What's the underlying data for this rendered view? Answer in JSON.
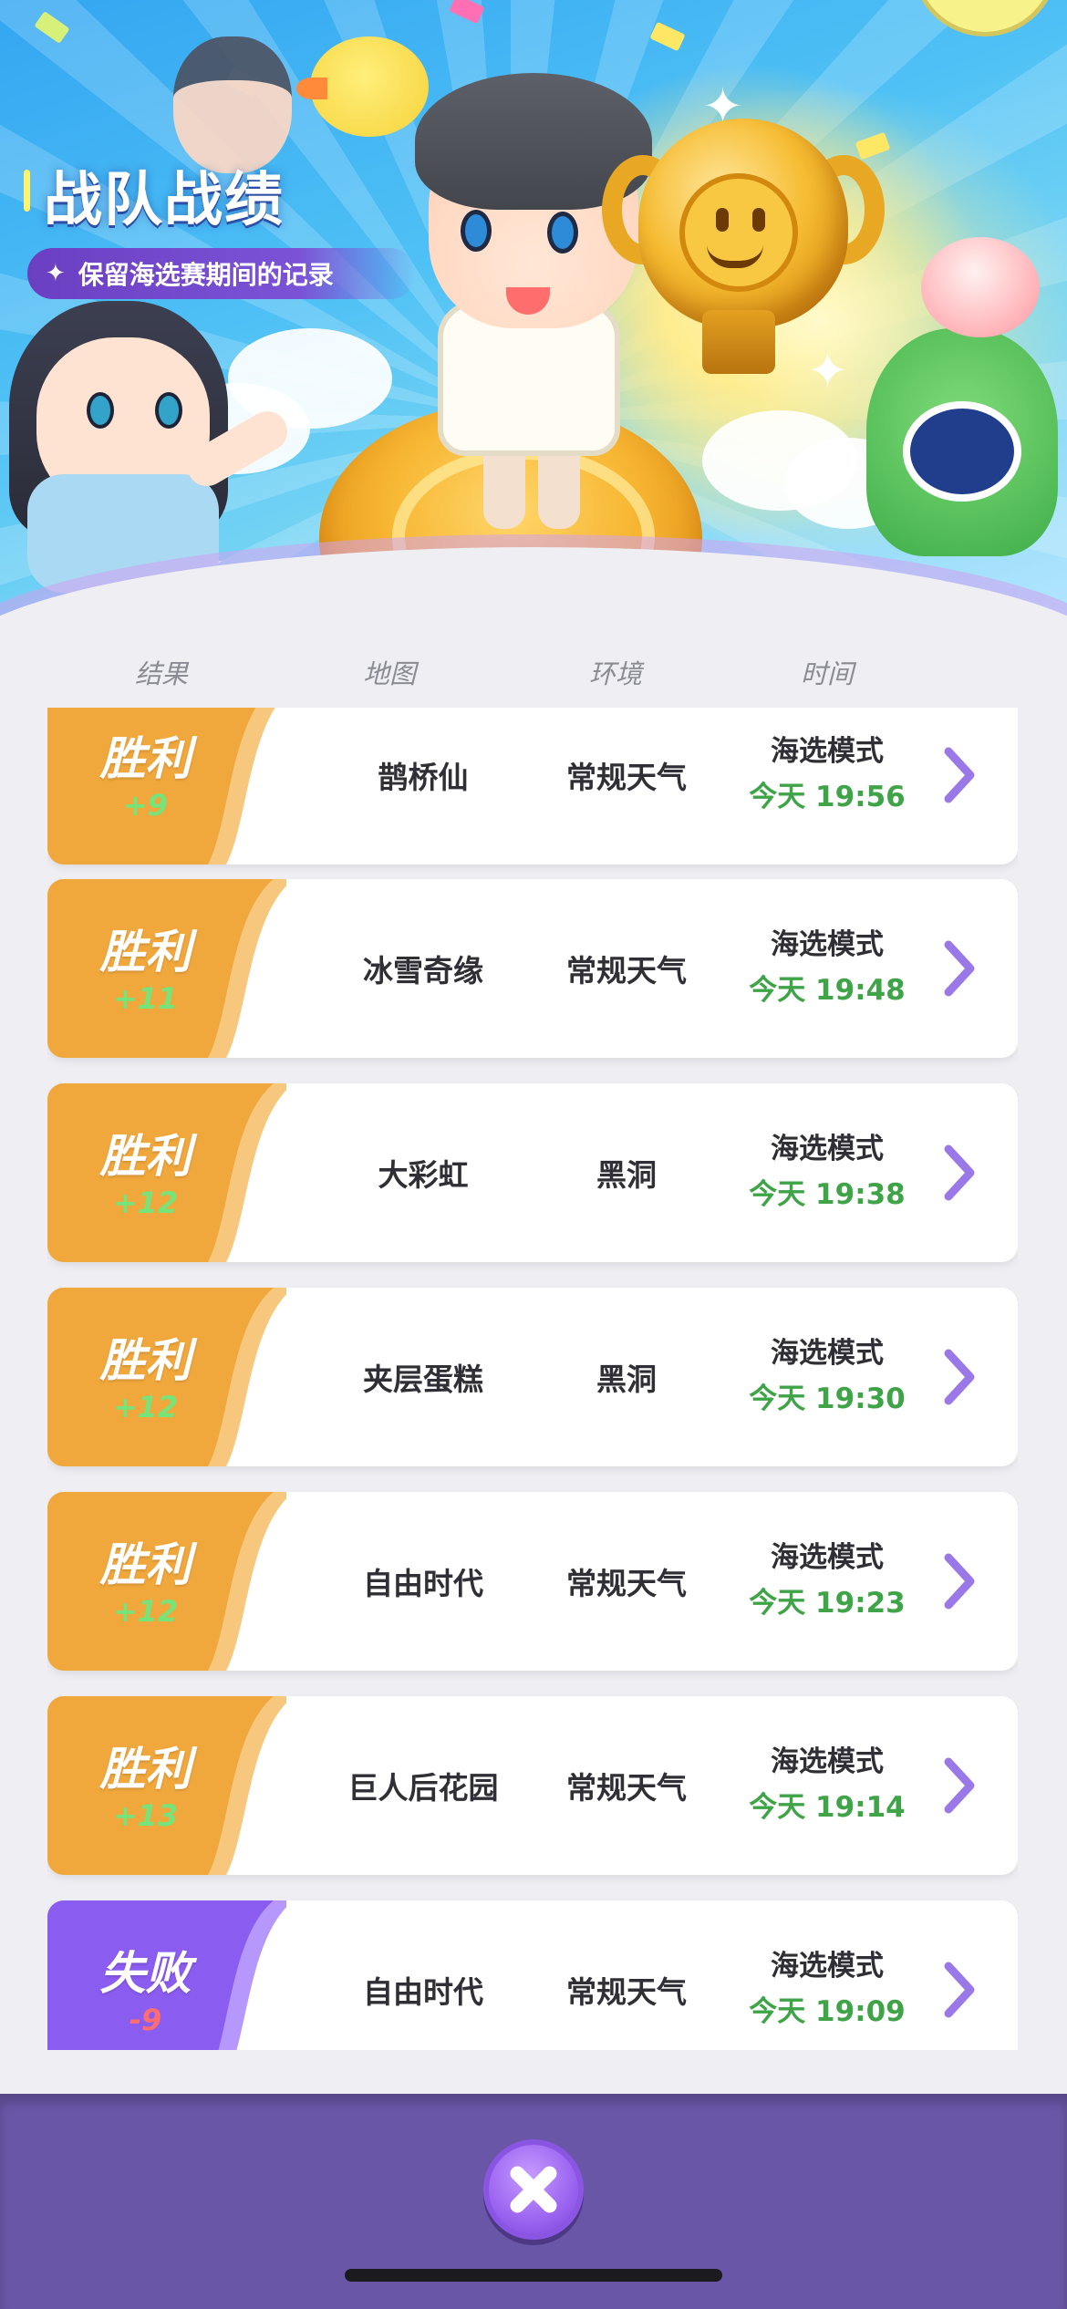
{
  "header": {
    "title": "战队战绩",
    "subtitle": "保留海选赛期间的记录",
    "subtitle_icon": "sparkle-icon"
  },
  "columns": [
    "结果",
    "地图",
    "环境",
    "时间"
  ],
  "records": [
    {
      "result": "胜利",
      "score": "+9",
      "map": "鹊桥仙",
      "env": "常规天气",
      "mode": "海选模式",
      "time": "今天 19:56",
      "outcome": "win"
    },
    {
      "result": "胜利",
      "score": "+11",
      "map": "冰雪奇缘",
      "env": "常规天气",
      "mode": "海选模式",
      "time": "今天 19:48",
      "outcome": "win"
    },
    {
      "result": "胜利",
      "score": "+12",
      "map": "大彩虹",
      "env": "黑洞",
      "mode": "海选模式",
      "time": "今天 19:38",
      "outcome": "win"
    },
    {
      "result": "胜利",
      "score": "+12",
      "map": "夹层蛋糕",
      "env": "黑洞",
      "mode": "海选模式",
      "time": "今天 19:30",
      "outcome": "win"
    },
    {
      "result": "胜利",
      "score": "+12",
      "map": "自由时代",
      "env": "常规天气",
      "mode": "海选模式",
      "time": "今天 19:23",
      "outcome": "win"
    },
    {
      "result": "胜利",
      "score": "+13",
      "map": "巨人后花园",
      "env": "常规天气",
      "mode": "海选模式",
      "time": "今天 19:14",
      "outcome": "win"
    },
    {
      "result": "失败",
      "score": "-9",
      "map": "自由时代",
      "env": "常规天气",
      "mode": "海选模式",
      "time": "今天 19:09",
      "outcome": "lose"
    }
  ],
  "colors": {
    "win_accent": "#f0a73c",
    "lose_accent": "#8b5cf0",
    "win_score": "#76e47a",
    "lose_score": "#ff6e6e",
    "time_green": "#3fa348",
    "arrow_purple": "#9a78e8",
    "bottom_bar": "#6a56a6"
  },
  "footer": {
    "close_icon": "close-icon"
  }
}
